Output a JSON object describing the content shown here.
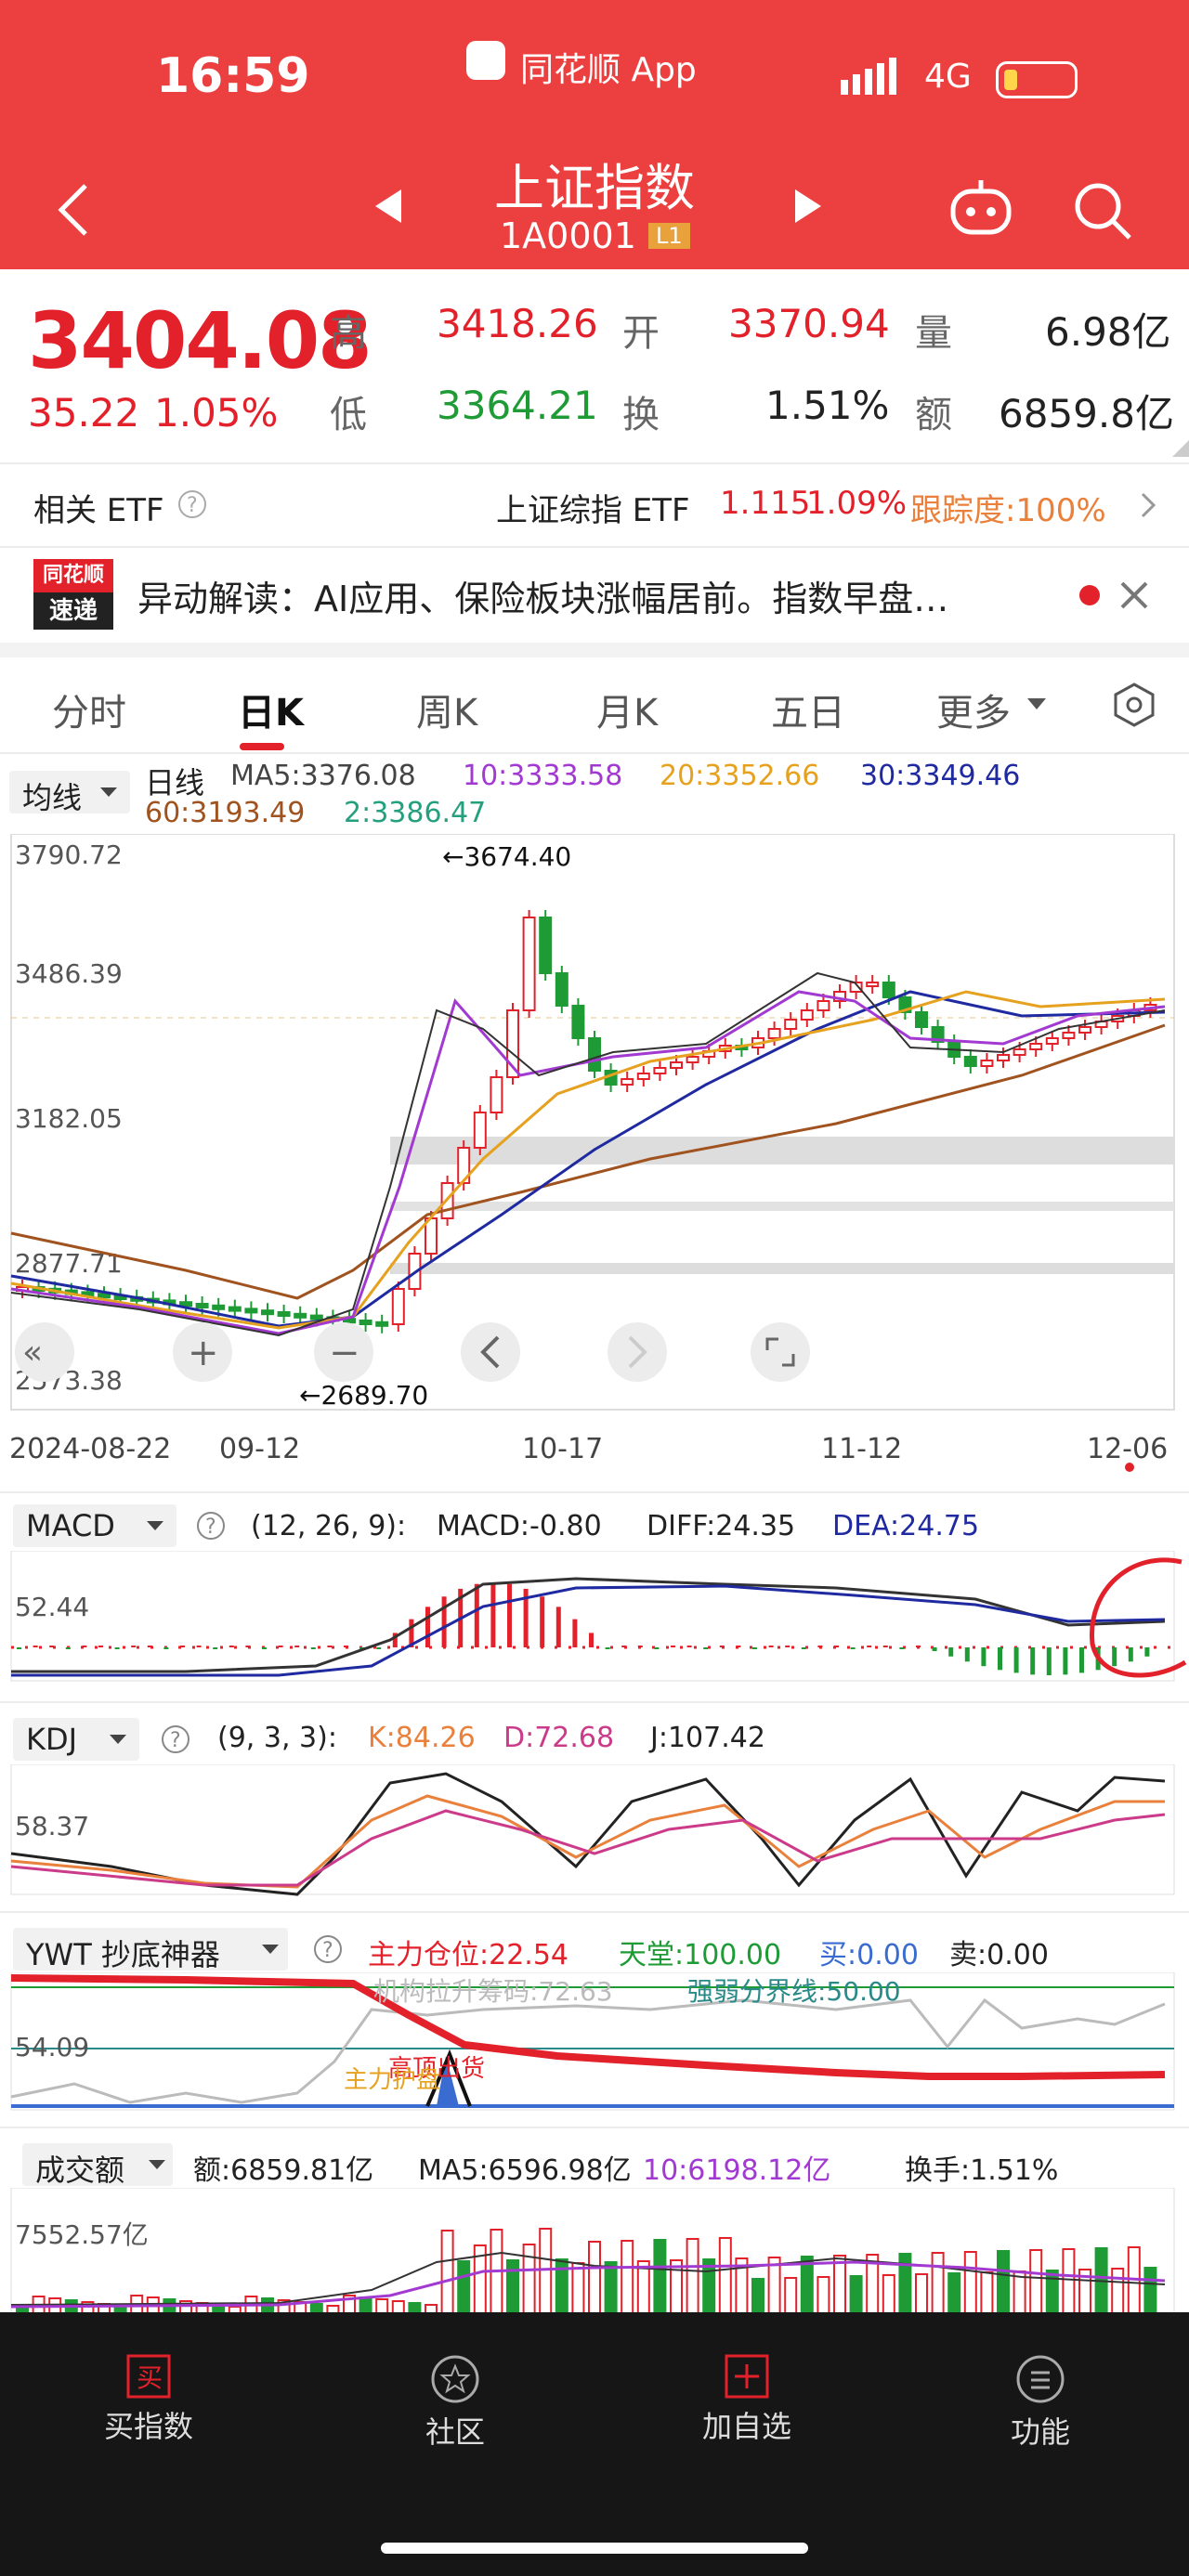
{
  "status_bar": {
    "time": "16:59",
    "app": "同花顺 App",
    "network": "4G"
  },
  "header": {
    "title": "上证指数",
    "code": "1A0001",
    "level": "L1"
  },
  "quote": {
    "price": "3404.08",
    "change": "35.22",
    "change_pct": "1.05%",
    "high_label": "高",
    "high": "3418.26",
    "low_label": "低",
    "low": "3364.21",
    "open_label": "开",
    "open": "3370.94",
    "turnover_label": "换",
    "turnover": "1.51%",
    "volume_label": "量",
    "volume": "6.98亿",
    "amount_label": "额",
    "amount": "6859.8亿"
  },
  "etf": {
    "label": "相关 ETF",
    "name": "上证综指 ETF",
    "price": "1.115",
    "pct": "1.09%",
    "tracking": "跟踪度:100%"
  },
  "news": {
    "badge_top": "同花顺",
    "badge_bottom": "速递",
    "text": "异动解读：AI应用、保险板块涨幅居前。指数早盘…"
  },
  "tabs": [
    "分时",
    "日K",
    "周K",
    "月K",
    "五日",
    "更多"
  ],
  "active_tab": "日K",
  "ma": {
    "selector": "均线",
    "period": "日线",
    "ma5": "MA5:3376.08",
    "ma10": "10:3333.58",
    "ma20": "20:3352.66",
    "ma30": "30:3349.46",
    "ma60": "60:3193.49",
    "ma2": "2:3386.47"
  },
  "kline": {
    "y_labels": [
      "3790.72",
      "3486.39",
      "3182.05",
      "2877.71",
      "2573.38"
    ],
    "max_label": "←3674.40",
    "min_label": "←2689.70",
    "dates": [
      "2024-08-22",
      "09-12",
      "10-17",
      "11-12",
      "12-06"
    ]
  },
  "macd": {
    "selector": "MACD",
    "params": "(12, 26, 9):",
    "macd": "MACD:-0.80",
    "diff": "DIFF:24.35",
    "dea": "DEA:24.75",
    "y_label": "52.44"
  },
  "kdj": {
    "selector": "KDJ",
    "params": "(9, 3, 3):",
    "k": "K:84.26",
    "d": "D:72.68",
    "j": "J:107.42",
    "y_label": "58.37"
  },
  "ywt": {
    "selector": "YWT 抄底神器",
    "main": "主力仓位:22.54",
    "tiantang": "天堂:100.00",
    "buy": "买:0.00",
    "sell": "卖:0.00",
    "jigou": "机构拉升筹码:72.63",
    "qiangruo": "强弱分界线:50.00",
    "y_label": "54.09",
    "ann1": "高顶出货",
    "ann2": "主力护盘"
  },
  "volume": {
    "selector": "成交额",
    "amount": "额:6859.81亿",
    "ma5": "MA5:6596.98亿",
    "ma10": "10:6198.12亿",
    "turnover": "换手:1.51%",
    "y_label": "7552.57亿"
  },
  "nav": [
    "买指数",
    "社区",
    "加自选",
    "功能"
  ],
  "colors": {
    "brand_red": "#ec3f3f",
    "up": "#e2212a",
    "down": "#1e9b35"
  }
}
